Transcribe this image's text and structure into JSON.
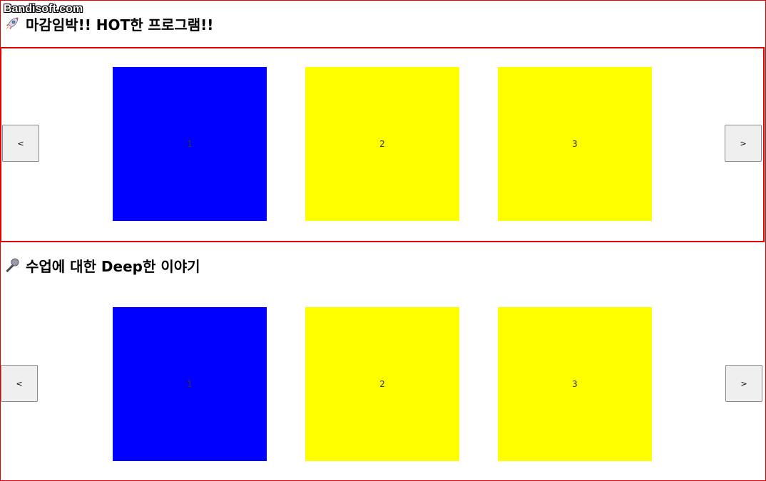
{
  "watermark": "Bandisoft.com",
  "sections": [
    {
      "heading": "마감임박!! HOT한 프로그램!!",
      "emoji_icon": "rocket-icon",
      "prev_label": "<",
      "next_label": ">",
      "slides": [
        {
          "label": "1",
          "color": "#0000ff"
        },
        {
          "label": "2",
          "color": "#ffff00"
        },
        {
          "label": "3",
          "color": "#ffff00"
        }
      ]
    },
    {
      "heading": "수업에 대한 Deep한 이야기",
      "emoji_icon": "microphone-icon",
      "prev_label": "<",
      "next_label": ">",
      "slides": [
        {
          "label": "1",
          "color": "#0000ff"
        },
        {
          "label": "2",
          "color": "#ffff00"
        },
        {
          "label": "3",
          "color": "#ffff00"
        }
      ]
    }
  ],
  "colors": {
    "border": "#e00000",
    "button_bg": "#efefef"
  }
}
